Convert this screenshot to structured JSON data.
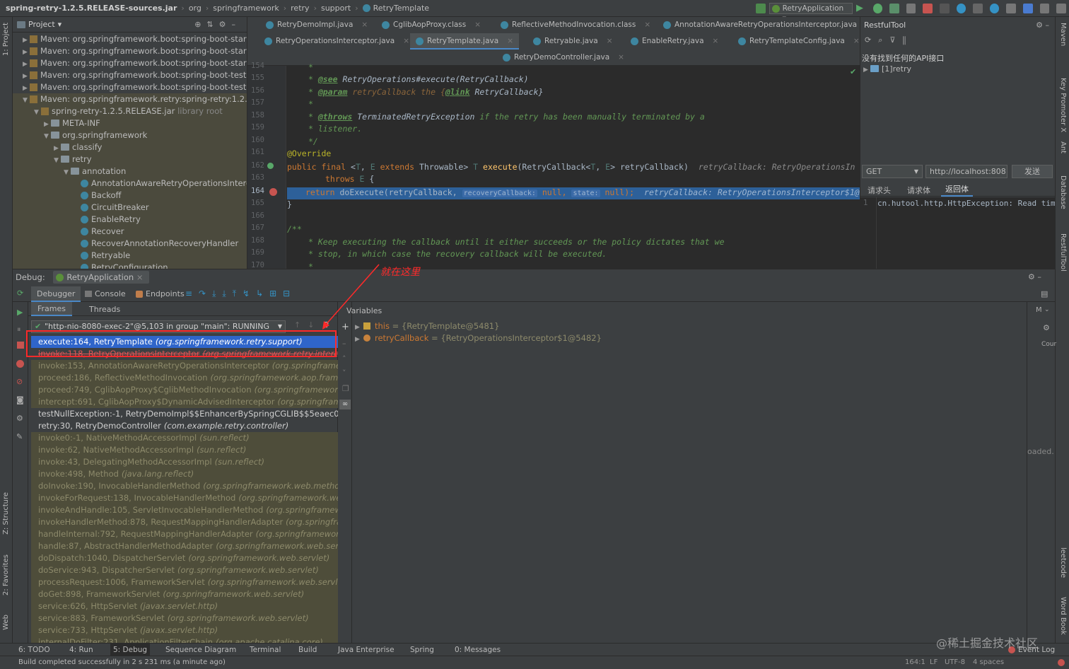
{
  "titlebar": {
    "breadcrumbs": [
      "spring-retry-1.2.5.RELEASE-sources.jar",
      "org",
      "springframework",
      "retry",
      "support",
      "RetryTemplate"
    ],
    "run_config": "RetryApplication"
  },
  "left_strip": {
    "project_label": "1: Project",
    "structure_label": "Z: Structure",
    "favorites_label": "2: Favorites",
    "web_label": "Web"
  },
  "right_strip": {
    "maven": "Maven",
    "key_promoter": "Key Promoter X",
    "ant": "Ant",
    "database": "Database",
    "restful": "RestfulTool",
    "leetcode": "leetcode",
    "wordbook": "Word Book"
  },
  "project": {
    "header": "Project",
    "rows": [
      {
        "text": "Maven: org.springframework.boot:spring-boot-starter",
        "note": ""
      },
      {
        "text": "Maven: org.springframework.boot:spring-boot-starter",
        "note": ""
      },
      {
        "text": "Maven: org.springframework.boot:spring-boot-starter",
        "note": ""
      },
      {
        "text": "Maven: org.springframework.boot:spring-boot-test:2.",
        "note": ""
      },
      {
        "text": "Maven: org.springframework.boot:spring-boot-test-a",
        "note": ""
      },
      {
        "text": "Maven: org.springframework.retry:spring-retry:1.2.5.R",
        "note": ""
      },
      {
        "text": "spring-retry-1.2.5.RELEASE.jar",
        "note": "library root"
      },
      {
        "text": "META-INF",
        "note": ""
      },
      {
        "text": "org.springframework",
        "note": ""
      },
      {
        "text": "classify",
        "note": ""
      },
      {
        "text": "retry",
        "note": ""
      },
      {
        "text": "annotation",
        "note": ""
      },
      {
        "text": "AnnotationAwareRetryOperationsInterce",
        "note": ""
      },
      {
        "text": "Backoff",
        "note": ""
      },
      {
        "text": "CircuitBreaker",
        "note": ""
      },
      {
        "text": "EnableRetry",
        "note": ""
      },
      {
        "text": "Recover",
        "note": ""
      },
      {
        "text": "RecoverAnnotationRecoveryHandler",
        "note": ""
      },
      {
        "text": "Retryable",
        "note": ""
      },
      {
        "text": "RetryConfiguration",
        "note": ""
      }
    ]
  },
  "editor": {
    "tabs_row1": [
      "RetryDemoImpl.java",
      "CglibAopProxy.class",
      "ReflectiveMethodInvocation.class",
      "AnnotationAwareRetryOperationsInterceptor.java"
    ],
    "tabs_row2": [
      "RetryOperationsInterceptor.java",
      "RetryTemplate.java",
      "Retryable.java",
      "EnableRetry.java",
      "RetryTemplateConfig.java"
    ],
    "tabs_row3": [
      "RetryDemoController.java"
    ],
    "line_numbers": [
      "154",
      "155",
      "156",
      "157",
      "158",
      "159",
      "160",
      "161",
      "162",
      "163",
      "164",
      "165",
      "166",
      "167",
      "168",
      "169",
      "170"
    ],
    "code": {
      "l154": "*",
      "l155_a": "* ",
      "l155_tag": "@see",
      "l155_b": " RetryOperations",
      "l155_c": "#execute",
      "l155_d": "(RetryCallback)",
      "l156_a": "* ",
      "l156_tag": "@param",
      "l156_b": " retryCallback the {",
      "l156_link": "@link",
      "l156_c": " RetryCallback}",
      "l157": "*",
      "l158_a": "* ",
      "l158_tag": "@throws",
      "l158_b": " TerminatedRetryException",
      "l158_c": " if the retry has been manually terminated by a",
      "l159": "* listener.",
      "l160": "*/",
      "l161": "@Override",
      "l162_kw": "public final",
      "l162_a": " <",
      "l162_t": "T",
      "l162_b": ", ",
      "l162_e": "E",
      "l162_kw2": " extends",
      "l162_c": " Throwable> ",
      "l162_t2": "T",
      "l162_fn": " execute",
      "l162_d": "(RetryCallback<",
      "l162_t3": "T",
      "l162_f": ", ",
      "l162_e2": "E",
      "l162_g": "> retryCallback)",
      "l162_hint": "retryCallback: RetryOperationsIn",
      "l163_kw": "throws",
      "l163_e": " E",
      "l163_b": " {",
      "l164_kw": "return",
      "l164_a": " doExecute(retryCallback,",
      "l164_p1": "recoveryCallback:",
      "l164_n1": "null,",
      "l164_p2": "state:",
      "l164_n2": "null);",
      "l164_hint": "retryCallback: RetryOperationsInterceptor$1@",
      "l165": "}",
      "l167": "/**",
      "l168": "* Keep executing the callback until it either succeeds or the policy dictates that we",
      "l169": "* stop, in which case the recovery callback will be executed.",
      "l170": "*"
    }
  },
  "restful": {
    "title": "RestfulTool",
    "no_api": "没有找到任何的API接口",
    "tree_item": "[1]retry",
    "method": "GET",
    "url": "http://localhost:808",
    "send": "发送",
    "tabs": [
      "请求头",
      "请求体",
      "返回体"
    ],
    "response_line_no": "1",
    "response": "cn.hutool.http.HttpException: Read tim"
  },
  "debug": {
    "label": "Debug:",
    "session": "RetryApplication",
    "tabs": [
      "Debugger",
      "Console",
      "Endpoints"
    ],
    "subtabs": [
      "Frames",
      "Threads"
    ],
    "thread": "\"http-nio-8080-exec-2\"@5,103 in group \"main\": RUNNING",
    "variables_title": "Variables",
    "variables": [
      {
        "name": "this",
        "value": "= {RetryTemplate@5481}"
      },
      {
        "name": "retryCallback",
        "value": "= {RetryOperationsInterceptor$1@5482}"
      }
    ],
    "right_partial": {
      "m": "M",
      "count": "Cour",
      "loaded": "oaded. L"
    },
    "annotation": "就在这里",
    "frames": [
      {
        "m": "execute:164, RetryTemplate",
        "p": "(org.springframework.retry.support)",
        "k": "sel"
      },
      {
        "m": "invoke:118, RetryOperationsInterceptor",
        "p": "(org.springframework.retry.interceptor)",
        "k": "strike"
      },
      {
        "m": "invoke:153, AnnotationAwareRetryOperationsInterceptor",
        "p": "(org.springframework",
        "k": "lib"
      },
      {
        "m": "proceed:186, ReflectiveMethodInvocation",
        "p": "(org.springframework.aop.framework",
        "k": "lib"
      },
      {
        "m": "proceed:749, CglibAopProxy$CglibMethodInvocation",
        "p": "(org.springframework.aop",
        "k": "lib"
      },
      {
        "m": "intercept:691, CglibAopProxy$DynamicAdvisedInterceptor",
        "p": "(org.springframewo",
        "k": "lib"
      },
      {
        "m": "testNullException:-1, RetryDemoImpl$$EnhancerBySpringCGLIB$$5eaec01",
        "p": "(co",
        "k": "user"
      },
      {
        "m": "retry:30, RetryDemoController",
        "p": "(com.example.retry.controller)",
        "k": "user"
      },
      {
        "m": "invoke0:-1, NativeMethodAccessorImpl",
        "p": "(sun.reflect)",
        "k": "lib"
      },
      {
        "m": "invoke:62, NativeMethodAccessorImpl",
        "p": "(sun.reflect)",
        "k": "lib"
      },
      {
        "m": "invoke:43, DelegatingMethodAccessorImpl",
        "p": "(sun.reflect)",
        "k": "lib"
      },
      {
        "m": "invoke:498, Method",
        "p": "(java.lang.reflect)",
        "k": "lib"
      },
      {
        "m": "doInvoke:190, InvocableHandlerMethod",
        "p": "(org.springframework.web.method.sup",
        "k": "lib"
      },
      {
        "m": "invokeForRequest:138, InvocableHandlerMethod",
        "p": "(org.springframework.web.me",
        "k": "lib"
      },
      {
        "m": "invokeAndHandle:105, ServletInvocableHandlerMethod",
        "p": "(org.springframework.w",
        "k": "lib"
      },
      {
        "m": "invokeHandlerMethod:878, RequestMappingHandlerAdapter",
        "p": "(org.springframew",
        "k": "lib"
      },
      {
        "m": "handleInternal:792, RequestMappingHandlerAdapter",
        "p": "(org.springframework.web",
        "k": "lib"
      },
      {
        "m": "handle:87, AbstractHandlerMethodAdapter",
        "p": "(org.springframework.web.servlet.m",
        "k": "lib"
      },
      {
        "m": "doDispatch:1040, DispatcherServlet",
        "p": "(org.springframework.web.servlet)",
        "k": "lib"
      },
      {
        "m": "doService:943, DispatcherServlet",
        "p": "(org.springframework.web.servlet)",
        "k": "lib"
      },
      {
        "m": "processRequest:1006, FrameworkServlet",
        "p": "(org.springframework.web.servlet)",
        "k": "lib"
      },
      {
        "m": "doGet:898, FrameworkServlet",
        "p": "(org.springframework.web.servlet)",
        "k": "lib"
      },
      {
        "m": "service:626, HttpServlet",
        "p": "(javax.servlet.http)",
        "k": "lib"
      },
      {
        "m": "service:883, FrameworkServlet",
        "p": "(org.springframework.web.servlet)",
        "k": "lib"
      },
      {
        "m": "service:733, HttpServlet",
        "p": "(javax.servlet.http)",
        "k": "lib"
      },
      {
        "m": "internalDoFilter:231, ApplicationFilterChain",
        "p": "(org.apache.catalina.core)",
        "k": "lib"
      }
    ]
  },
  "bottom_tools": [
    "6: TODO",
    "4: Run",
    "5: Debug",
    "Sequence Diagram",
    "Terminal",
    "Build",
    "Java Enterprise",
    "Spring",
    "0: Messages",
    "Event Log"
  ],
  "status": {
    "message": "Build completed successfully in 2 s 231 ms (a minute ago)",
    "position": "164:1",
    "line_sep": "LF",
    "encoding": "UTF-8",
    "indent": "4 spaces",
    "watermark": "@稀土掘金技术社区"
  },
  "colors": {
    "highlight": "#2d6099",
    "selection": "#2f65ca",
    "annotation_red": "#ff2a2a"
  }
}
